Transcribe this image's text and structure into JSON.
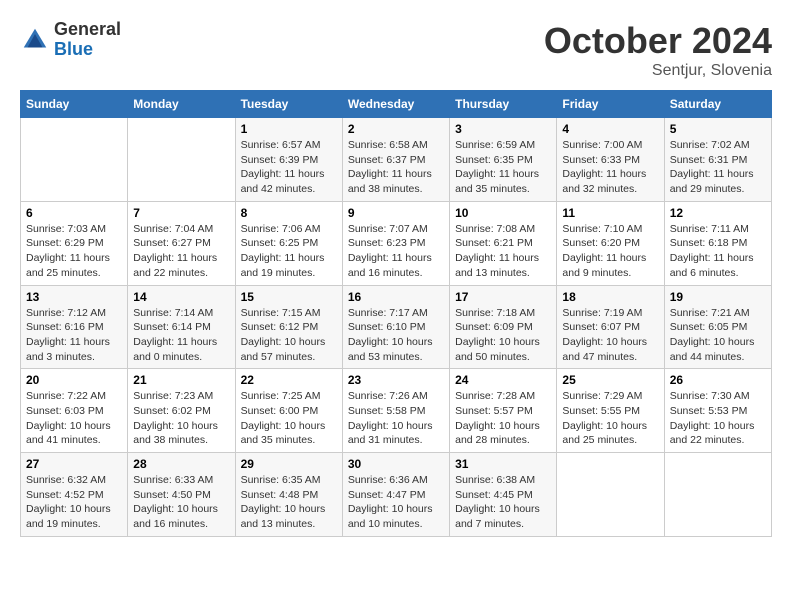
{
  "header": {
    "logo": {
      "general": "General",
      "blue": "Blue"
    },
    "month": "October 2024",
    "location": "Sentjur, Slovenia"
  },
  "days_of_week": [
    "Sunday",
    "Monday",
    "Tuesday",
    "Wednesday",
    "Thursday",
    "Friday",
    "Saturday"
  ],
  "weeks": [
    [
      {
        "day": "",
        "info": ""
      },
      {
        "day": "",
        "info": ""
      },
      {
        "day": "1",
        "sunrise": "6:57 AM",
        "sunset": "6:39 PM",
        "daylight": "11 hours and 42 minutes."
      },
      {
        "day": "2",
        "sunrise": "6:58 AM",
        "sunset": "6:37 PM",
        "daylight": "11 hours and 38 minutes."
      },
      {
        "day": "3",
        "sunrise": "6:59 AM",
        "sunset": "6:35 PM",
        "daylight": "11 hours and 35 minutes."
      },
      {
        "day": "4",
        "sunrise": "7:00 AM",
        "sunset": "6:33 PM",
        "daylight": "11 hours and 32 minutes."
      },
      {
        "day": "5",
        "sunrise": "7:02 AM",
        "sunset": "6:31 PM",
        "daylight": "11 hours and 29 minutes."
      }
    ],
    [
      {
        "day": "6",
        "sunrise": "7:03 AM",
        "sunset": "6:29 PM",
        "daylight": "11 hours and 25 minutes."
      },
      {
        "day": "7",
        "sunrise": "7:04 AM",
        "sunset": "6:27 PM",
        "daylight": "11 hours and 22 minutes."
      },
      {
        "day": "8",
        "sunrise": "7:06 AM",
        "sunset": "6:25 PM",
        "daylight": "11 hours and 19 minutes."
      },
      {
        "day": "9",
        "sunrise": "7:07 AM",
        "sunset": "6:23 PM",
        "daylight": "11 hours and 16 minutes."
      },
      {
        "day": "10",
        "sunrise": "7:08 AM",
        "sunset": "6:21 PM",
        "daylight": "11 hours and 13 minutes."
      },
      {
        "day": "11",
        "sunrise": "7:10 AM",
        "sunset": "6:20 PM",
        "daylight": "11 hours and 9 minutes."
      },
      {
        "day": "12",
        "sunrise": "7:11 AM",
        "sunset": "6:18 PM",
        "daylight": "11 hours and 6 minutes."
      }
    ],
    [
      {
        "day": "13",
        "sunrise": "7:12 AM",
        "sunset": "6:16 PM",
        "daylight": "11 hours and 3 minutes."
      },
      {
        "day": "14",
        "sunrise": "7:14 AM",
        "sunset": "6:14 PM",
        "daylight": "11 hours and 0 minutes."
      },
      {
        "day": "15",
        "sunrise": "7:15 AM",
        "sunset": "6:12 PM",
        "daylight": "10 hours and 57 minutes."
      },
      {
        "day": "16",
        "sunrise": "7:17 AM",
        "sunset": "6:10 PM",
        "daylight": "10 hours and 53 minutes."
      },
      {
        "day": "17",
        "sunrise": "7:18 AM",
        "sunset": "6:09 PM",
        "daylight": "10 hours and 50 minutes."
      },
      {
        "day": "18",
        "sunrise": "7:19 AM",
        "sunset": "6:07 PM",
        "daylight": "10 hours and 47 minutes."
      },
      {
        "day": "19",
        "sunrise": "7:21 AM",
        "sunset": "6:05 PM",
        "daylight": "10 hours and 44 minutes."
      }
    ],
    [
      {
        "day": "20",
        "sunrise": "7:22 AM",
        "sunset": "6:03 PM",
        "daylight": "10 hours and 41 minutes."
      },
      {
        "day": "21",
        "sunrise": "7:23 AM",
        "sunset": "6:02 PM",
        "daylight": "10 hours and 38 minutes."
      },
      {
        "day": "22",
        "sunrise": "7:25 AM",
        "sunset": "6:00 PM",
        "daylight": "10 hours and 35 minutes."
      },
      {
        "day": "23",
        "sunrise": "7:26 AM",
        "sunset": "5:58 PM",
        "daylight": "10 hours and 31 minutes."
      },
      {
        "day": "24",
        "sunrise": "7:28 AM",
        "sunset": "5:57 PM",
        "daylight": "10 hours and 28 minutes."
      },
      {
        "day": "25",
        "sunrise": "7:29 AM",
        "sunset": "5:55 PM",
        "daylight": "10 hours and 25 minutes."
      },
      {
        "day": "26",
        "sunrise": "7:30 AM",
        "sunset": "5:53 PM",
        "daylight": "10 hours and 22 minutes."
      }
    ],
    [
      {
        "day": "27",
        "sunrise": "6:32 AM",
        "sunset": "4:52 PM",
        "daylight": "10 hours and 19 minutes."
      },
      {
        "day": "28",
        "sunrise": "6:33 AM",
        "sunset": "4:50 PM",
        "daylight": "10 hours and 16 minutes."
      },
      {
        "day": "29",
        "sunrise": "6:35 AM",
        "sunset": "4:48 PM",
        "daylight": "10 hours and 13 minutes."
      },
      {
        "day": "30",
        "sunrise": "6:36 AM",
        "sunset": "4:47 PM",
        "daylight": "10 hours and 10 minutes."
      },
      {
        "day": "31",
        "sunrise": "6:38 AM",
        "sunset": "4:45 PM",
        "daylight": "10 hours and 7 minutes."
      },
      {
        "day": "",
        "info": ""
      },
      {
        "day": "",
        "info": ""
      }
    ]
  ],
  "labels": {
    "sunrise": "Sunrise:",
    "sunset": "Sunset:",
    "daylight": "Daylight:"
  }
}
